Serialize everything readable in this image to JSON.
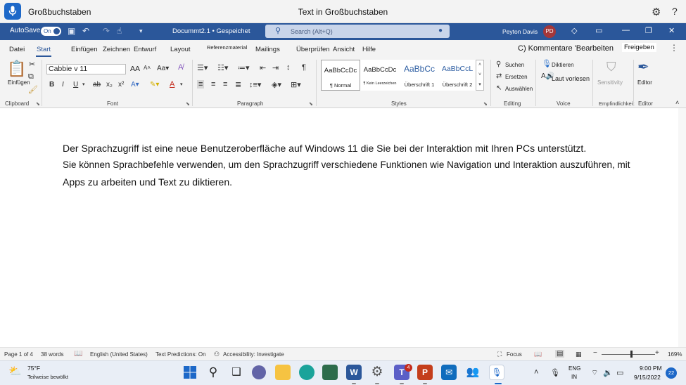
{
  "voice": {
    "status": "Großbuchstaben",
    "hint": "Text in Großbuchstaben",
    "settings_icon": "gear-icon",
    "help_icon": "?"
  },
  "titlebar": {
    "autosave_label": "AutoSave",
    "autosave_state": "On",
    "doc_title": "Docummt2.1 • Gespeichet",
    "search_placeholder": "Search (Alt+Q)",
    "user_name": "Peyton Davis",
    "avatar_initials": "PD"
  },
  "tabs": [
    "Datei",
    "Start",
    "Einfügen",
    "Zeichnen",
    "Entwurf",
    "Layout",
    "Referenzmaterial",
    "Mailings",
    "Überprüfen",
    "Ansicht",
    "Hilfe"
  ],
  "selected_tab": "Start",
  "ribbon_right": {
    "comments": "C) Kommentare 'Bearbeiten",
    "share": "Freigeben"
  },
  "ribbon": {
    "paste_label": "Einfügen",
    "font_name": "Cabbie v 11",
    "font_size": "AA",
    "style_normal_prev": "AaBbCcDc",
    "style_normal": "¶ Normal",
    "style_nospacing_prev": "AaBbCcDc",
    "style_nospacing": "¶ Kein Leerzeichen",
    "style_h1_prev": "AaBbCc",
    "style_h1": "Überschrift 1",
    "style_h2_prev": "AaBbCcL",
    "style_h2": "Überschrift 2",
    "find": "Suchen",
    "replace": "Ersetzen",
    "select": "Auswählen",
    "dictate": "Diktieren",
    "read_aloud": "Laut vorlesen",
    "sensitivity": "Sensitivity",
    "editor": "Editor"
  },
  "groups": {
    "clipboard": "Clipboard",
    "font": "Font",
    "paragraph": "Paragraph",
    "styles": "Styles",
    "editing": "Editing",
    "voice": "Voice",
    "sensitivity": "Empfindlichkeit",
    "editor": "Editor"
  },
  "document": {
    "line1": "Der Sprachzugriff ist eine neue Benutzeroberfläche auf Windows 11 die Sie bei der Interaktion mit Ihren PCs unterstützt.",
    "line2": "Sie können Sprachbefehle verwenden, um den Sprachzugriff verschiedene Funktionen wie Navigation und Interaktion auszuführen, mit",
    "line3": "Apps zu arbeiten und Text zu diktieren."
  },
  "status": {
    "page": "Page 1 of 4",
    "words": "38 words",
    "language": "English (United States)",
    "predictions": "Text Predictions: On",
    "accessibility": "Accessibility: Investigate",
    "focus": "Focus",
    "zoom": "169%",
    "zoom_fraction": 0.55
  },
  "taskbar": {
    "temp": "75°F",
    "weather": "Teilweise bewölkt",
    "teams_badge": "4",
    "lang1": "ENG",
    "lang2": "IN",
    "time": "9:00 PM",
    "date": "9/15/2022",
    "notifications": "22"
  },
  "colors": {
    "word_blue": "#2b579a",
    "win_accent": "#1d68c8"
  }
}
